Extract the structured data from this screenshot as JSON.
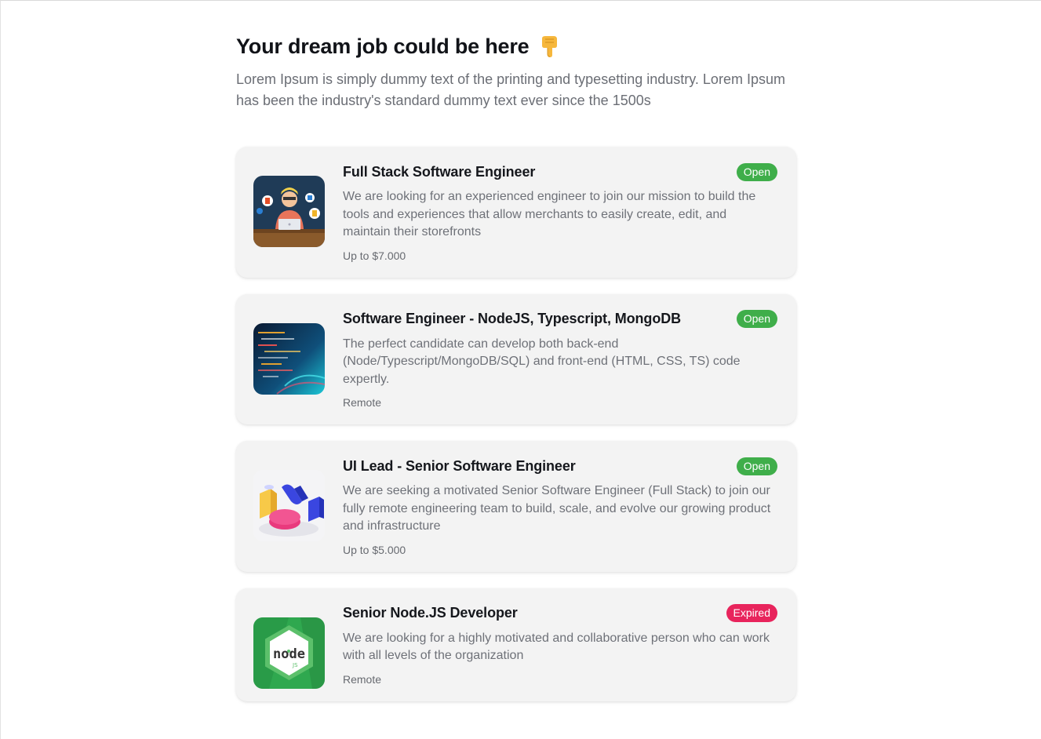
{
  "header": {
    "title": "Your dream job could be here",
    "subtitle": "Lorem Ipsum is simply dummy text of the printing and typesetting industry. Lorem Ipsum has been the industry's standard dummy text ever since the 1500s"
  },
  "jobs": [
    {
      "title": "Full Stack Software Engineer",
      "status": "Open",
      "description": "We are looking for an experienced engineer to join our mission to build the tools and experiences that allow merchants to easily create, edit, and maintain their storefronts",
      "meta": "Up to $7.000"
    },
    {
      "title": "Software Engineer - NodeJS, Typescript, MongoDB",
      "status": "Open",
      "description": "The perfect candidate can develop both back-end (Node/Typescript/MongoDB/SQL) and front-end (HTML, CSS, TS) code expertly.",
      "meta": "Remote"
    },
    {
      "title": "UI Lead - Senior Software Engineer",
      "status": "Open",
      "description": "We are seeking a motivated Senior Software Engineer (Full Stack) to join our fully remote engineering team to build, scale, and evolve our growing product and infrastructure",
      "meta": "Up to $5.000"
    },
    {
      "title": "Senior Node.JS Developer",
      "status": "Expired",
      "description": "We are looking for a highly motivated and collaborative person who can work with all levels of the organization",
      "meta": "Remote"
    }
  ],
  "thumbnail_logo_text": "node",
  "colors": {
    "open": "#3fae4a",
    "expired": "#e8245c"
  }
}
